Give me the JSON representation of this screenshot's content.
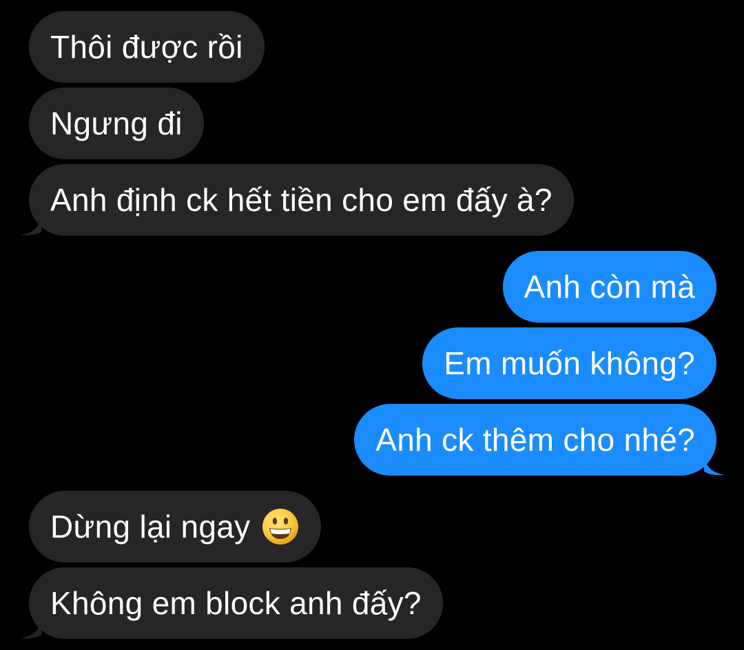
{
  "conversation": {
    "colors": {
      "background": "#000000",
      "incoming_bubble": "#262628",
      "outgoing_bubble": "#1a8cfe",
      "text": "#ffffff"
    },
    "messages": [
      {
        "direction": "incoming",
        "text": "Thôi được rồi"
      },
      {
        "direction": "incoming",
        "text": "Ngưng đi"
      },
      {
        "direction": "incoming",
        "text": "Anh định ck hết tiền cho em đấy à?"
      },
      {
        "direction": "outgoing",
        "text": "Anh còn mà"
      },
      {
        "direction": "outgoing",
        "text": "Em muốn không?"
      },
      {
        "direction": "outgoing",
        "text": "Anh ck thêm cho nhé?"
      },
      {
        "direction": "incoming",
        "text": "Dừng lại ngay",
        "emoji": "grinning-face-emoji"
      },
      {
        "direction": "incoming",
        "text": "Không em block anh đấy?"
      }
    ]
  }
}
